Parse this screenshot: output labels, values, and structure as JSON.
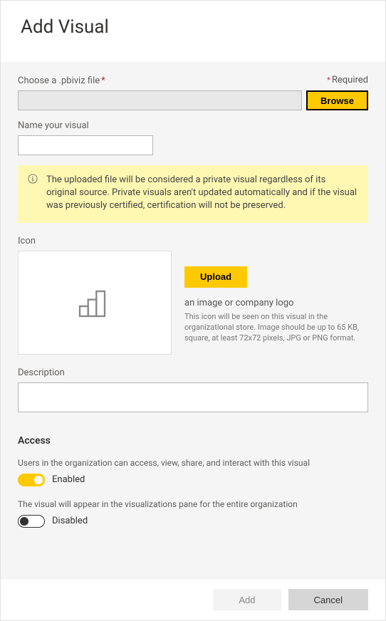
{
  "header": {
    "title": "Add Visual"
  },
  "required_label": "Required",
  "file": {
    "label": "Choose a .pbiviz file",
    "browse": "Browse"
  },
  "name": {
    "label": "Name your visual"
  },
  "notice": "The uploaded file will be considered a private visual regardless of its original source. Private visuals aren't updated automatically and if the visual was previously certified, certification will not be preserved.",
  "icon": {
    "label": "Icon",
    "upload": "Upload",
    "title": "an image or company logo",
    "desc": "This icon will be seen on this visual in the organizational store. Image should be up to 65 KB, square, at least 72x72 pixels, JPG or PNG format."
  },
  "description": {
    "label": "Description"
  },
  "access": {
    "header": "Access",
    "items": [
      {
        "desc": "Users in the organization can access, view, share, and interact with this visual",
        "state": "Enabled"
      },
      {
        "desc": "The visual will appear in the visualizations pane for the entire organization",
        "state": "Disabled"
      }
    ]
  },
  "footer": {
    "add": "Add",
    "cancel": "Cancel"
  }
}
